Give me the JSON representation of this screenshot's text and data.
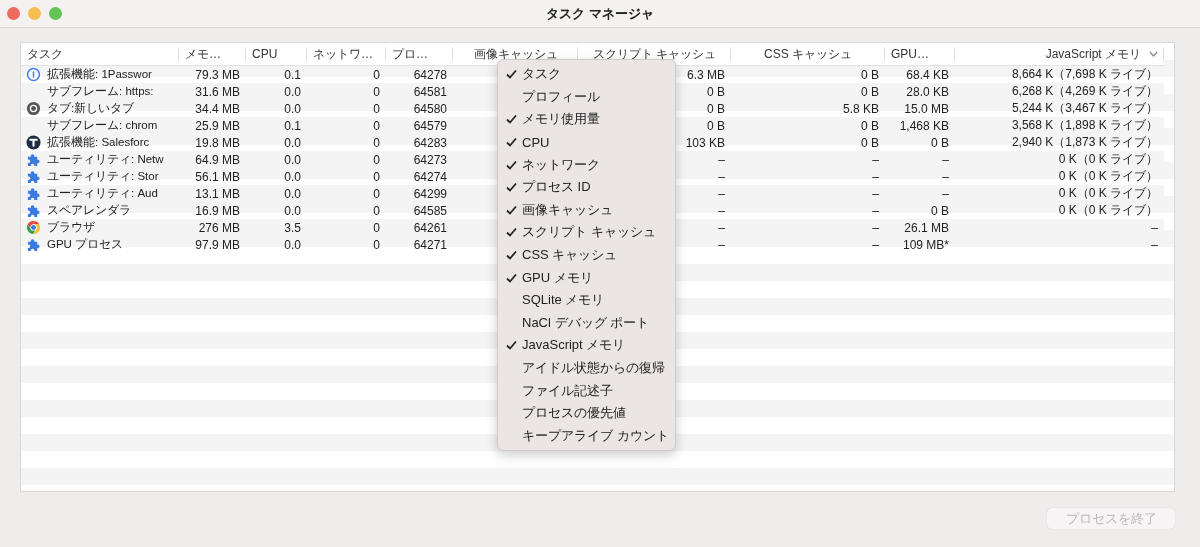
{
  "window": {
    "title": "タスク マネージャ"
  },
  "table": {
    "columns": [
      {
        "label": "タスク",
        "sorted": false
      },
      {
        "label": "メモ…",
        "sorted": false
      },
      {
        "label": "CPU",
        "sorted": false
      },
      {
        "label": "ネットワ…",
        "sorted": false
      },
      {
        "label": "プロ…",
        "sorted": false
      },
      {
        "label": "画像キャッシュ",
        "sorted": false
      },
      {
        "label": "スクリプト キャッシュ",
        "sorted": false
      },
      {
        "label": "CSS キャッシュ",
        "sorted": false
      },
      {
        "label": "GPU…",
        "sorted": false
      },
      {
        "label": "JavaScript メモリ",
        "sorted": true
      }
    ],
    "rows": [
      {
        "kind": "info",
        "task": "拡張機能: 1Passwor",
        "memory": "79.3 MB",
        "cpu": "0.1",
        "network": "0",
        "pid": "64278",
        "script_cache": "6.3 MB",
        "css_cache": "0 B",
        "gpu_memory": "68.4 KB",
        "js_memory": "8,664 K（7,698 K ライブ）"
      },
      {
        "kind": "plain",
        "task": "サブフレーム: https:",
        "memory": "31.6 MB",
        "cpu": "0.0",
        "network": "0",
        "pid": "64581",
        "script_cache": "0 B",
        "css_cache": "0 B",
        "gpu_memory": "28.0 KB",
        "js_memory": "6,268 K（4,269 K ライブ）"
      },
      {
        "kind": "tab",
        "task": "タブ:新しいタブ",
        "memory": "34.4 MB",
        "cpu": "0.0",
        "network": "0",
        "pid": "64580",
        "script_cache": "0 B",
        "css_cache": "5.8 KB",
        "gpu_memory": "15.0 MB",
        "js_memory": "5,244 K（3,467 K ライブ）"
      },
      {
        "kind": "plain",
        "task": "サブフレーム: chrom",
        "memory": "25.9 MB",
        "cpu": "0.1",
        "network": "0",
        "pid": "64579",
        "script_cache": "0 B",
        "css_cache": "0 B",
        "gpu_memory": "1,468 KB",
        "js_memory": "3,568 K（1,898 K ライブ）"
      },
      {
        "kind": "badge",
        "task": "拡張機能: Salesforc",
        "memory": "19.8 MB",
        "cpu": "0.0",
        "network": "0",
        "pid": "64283",
        "script_cache": "103 KB",
        "css_cache": "0 B",
        "gpu_memory": "0 B",
        "js_memory": "2,940 K（1,873 K ライブ）"
      },
      {
        "kind": "extension",
        "task": "ユーティリティ: Netw",
        "memory": "64.9 MB",
        "cpu": "0.0",
        "network": "0",
        "pid": "64273",
        "script_cache": "–",
        "css_cache": "–",
        "gpu_memory": "–",
        "js_memory": "0 K（0 K ライブ）"
      },
      {
        "kind": "extension",
        "task": "ユーティリティ: Stor",
        "memory": "56.1 MB",
        "cpu": "0.0",
        "network": "0",
        "pid": "64274",
        "script_cache": "–",
        "css_cache": "–",
        "gpu_memory": "–",
        "js_memory": "0 K（0 K ライブ）"
      },
      {
        "kind": "extension",
        "task": "ユーティリティ: Aud",
        "memory": "13.1 MB",
        "cpu": "0.0",
        "network": "0",
        "pid": "64299",
        "script_cache": "–",
        "css_cache": "–",
        "gpu_memory": "–",
        "js_memory": "0 K（0 K ライブ）"
      },
      {
        "kind": "extension",
        "task": "スペアレンダラ",
        "memory": "16.9 MB",
        "cpu": "0.0",
        "network": "0",
        "pid": "64585",
        "script_cache": "–",
        "css_cache": "–",
        "gpu_memory": "0 B",
        "js_memory": "0 K（0 K ライブ）"
      },
      {
        "kind": "browser",
        "task": "ブラウザ",
        "memory": "276 MB",
        "cpu": "3.5",
        "network": "0",
        "pid": "64261",
        "script_cache": "–",
        "css_cache": "–",
        "gpu_memory": "26.1 MB",
        "js_memory": "–"
      },
      {
        "kind": "extension",
        "task": "GPU プロセス",
        "memory": "97.9 MB",
        "cpu": "0.0",
        "network": "0",
        "pid": "64271",
        "script_cache": "–",
        "css_cache": "–",
        "gpu_memory": "109 MB*",
        "js_memory": "–"
      }
    ]
  },
  "column_menu": {
    "items": [
      {
        "label": "タスク",
        "checked": true
      },
      {
        "label": "プロフィール",
        "checked": false
      },
      {
        "label": "メモリ使用量",
        "checked": true
      },
      {
        "label": "CPU",
        "checked": true
      },
      {
        "label": "ネットワーク",
        "checked": true
      },
      {
        "label": "プロセス ID",
        "checked": true
      },
      {
        "label": "画像キャッシュ",
        "checked": true
      },
      {
        "label": "スクリプト キャッシュ",
        "checked": true
      },
      {
        "label": "CSS キャッシュ",
        "checked": true
      },
      {
        "label": "GPU メモリ",
        "checked": true
      },
      {
        "label": "SQLite メモリ",
        "checked": false
      },
      {
        "label": "NaCl デバッグ ポート",
        "checked": false
      },
      {
        "label": "JavaScript メモリ",
        "checked": true
      },
      {
        "label": "アイドル状態からの復帰",
        "checked": false
      },
      {
        "label": "ファイル記述子",
        "checked": false
      },
      {
        "label": "プロセスの優先値",
        "checked": false
      },
      {
        "label": "キープアライブ カウント",
        "checked": false
      }
    ]
  },
  "end_process_button": {
    "label": "プロセスを終了",
    "disabled": true
  }
}
